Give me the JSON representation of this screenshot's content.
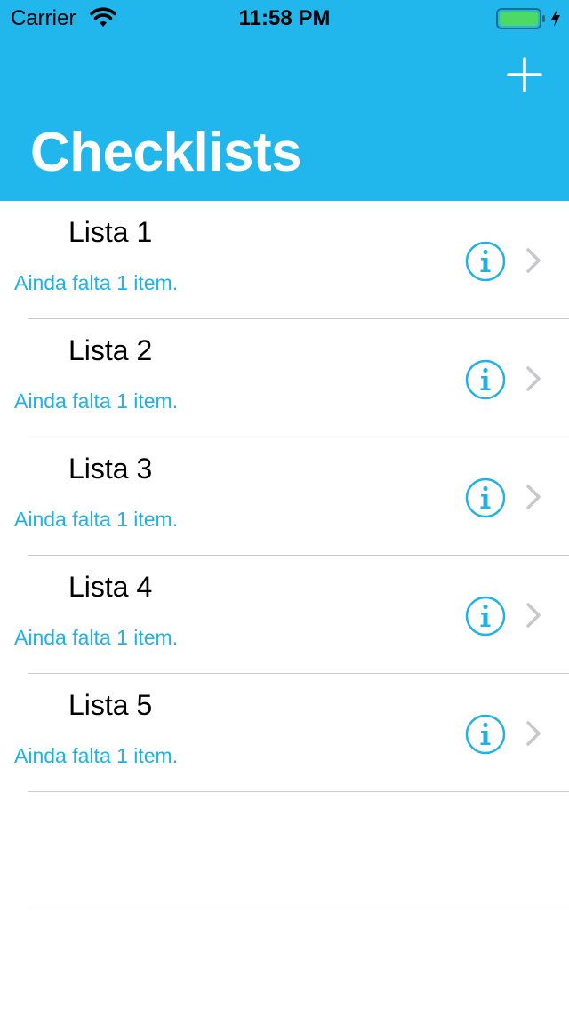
{
  "status_bar": {
    "carrier": "Carrier",
    "time": "11:58 PM",
    "icons": [
      "wifi-icon",
      "battery-icon",
      "charging-icon"
    ],
    "battery_color": "#4cd964"
  },
  "nav": {
    "title": "Checklists",
    "add_icon": "plus-icon",
    "background_color": "#21b7ec"
  },
  "checklists": [
    {
      "title": "Lista 1",
      "subtitle": "Ainda falta 1 item."
    },
    {
      "title": "Lista 2",
      "subtitle": "Ainda falta 1 item."
    },
    {
      "title": "Lista 3",
      "subtitle": "Ainda falta 1 item."
    },
    {
      "title": "Lista 4",
      "subtitle": "Ainda falta 1 item."
    },
    {
      "title": "Lista 5",
      "subtitle": "Ainda falta 1 item."
    }
  ],
  "accent_color": "#21b1e6"
}
